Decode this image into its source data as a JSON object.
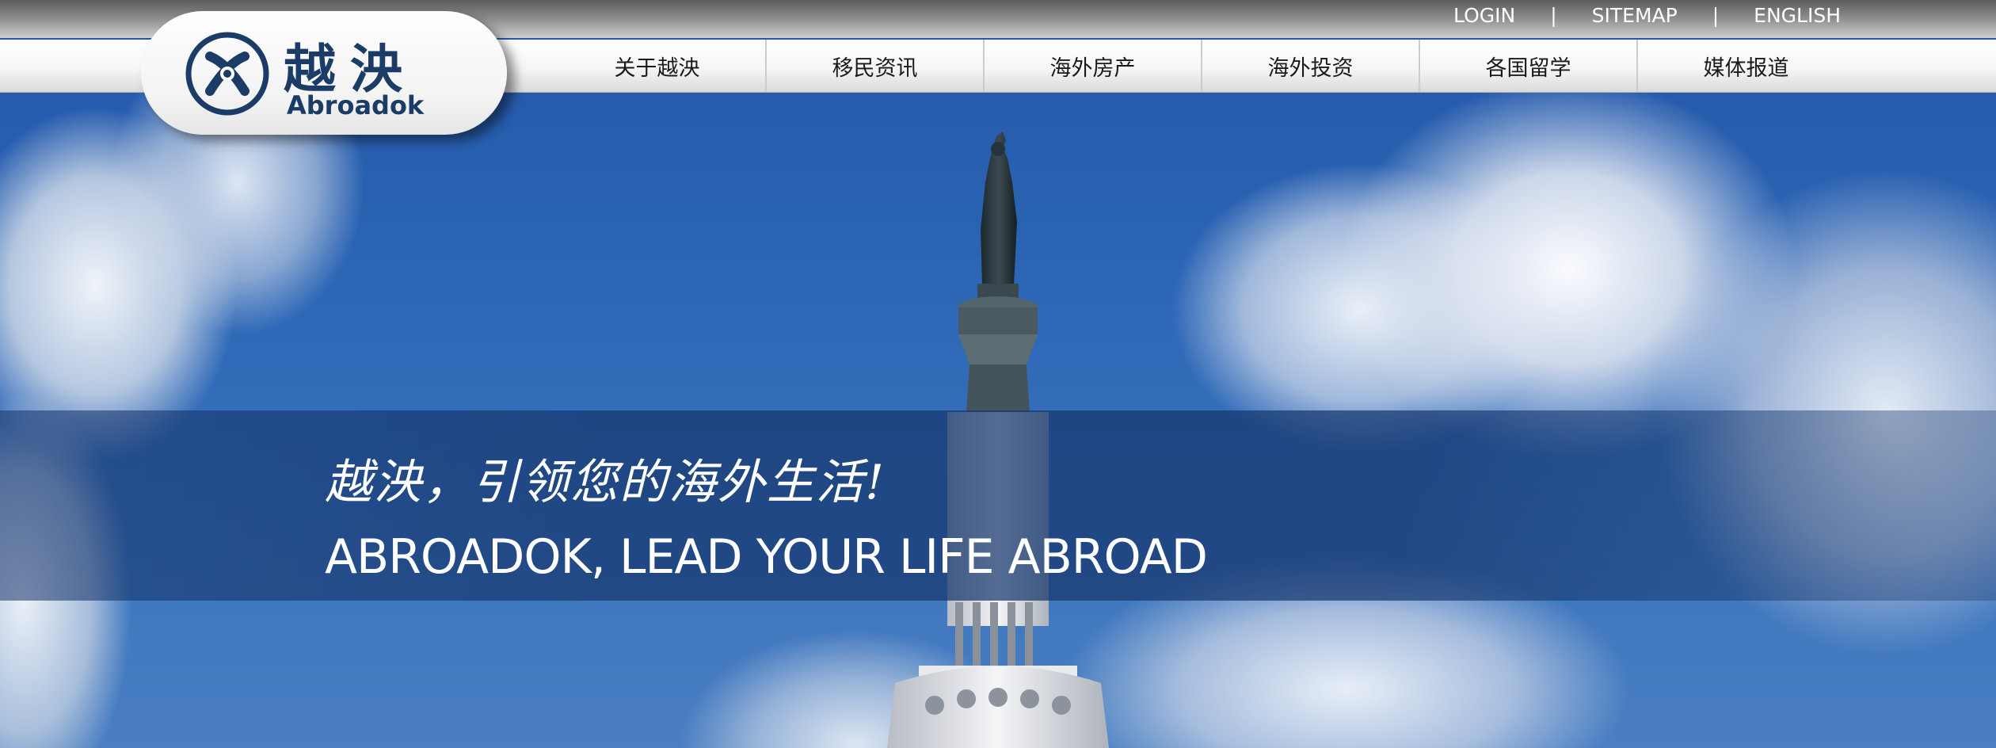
{
  "header": {
    "utility_links": [
      {
        "label": "LOGIN"
      },
      {
        "label": "SITEMAP"
      },
      {
        "label": "ENGLISH"
      }
    ],
    "separator": "|",
    "logo": {
      "cn": "越泱",
      "en": "Abroadok"
    },
    "nav": [
      {
        "label": "关于越泱"
      },
      {
        "label": "移民资讯"
      },
      {
        "label": "海外房产"
      },
      {
        "label": "海外投资"
      },
      {
        "label": "各国留学"
      },
      {
        "label": "媒体报道"
      }
    ]
  },
  "hero": {
    "tagline_cn": "越泱，引领您的海外生活!",
    "tagline_en": "ABROADOK, LEAD YOUR LIFE ABROAD"
  },
  "colors": {
    "brand_navy": "#1b3c66",
    "sky_blue": "#2d67b6",
    "banner_overlay": "#16376e"
  }
}
